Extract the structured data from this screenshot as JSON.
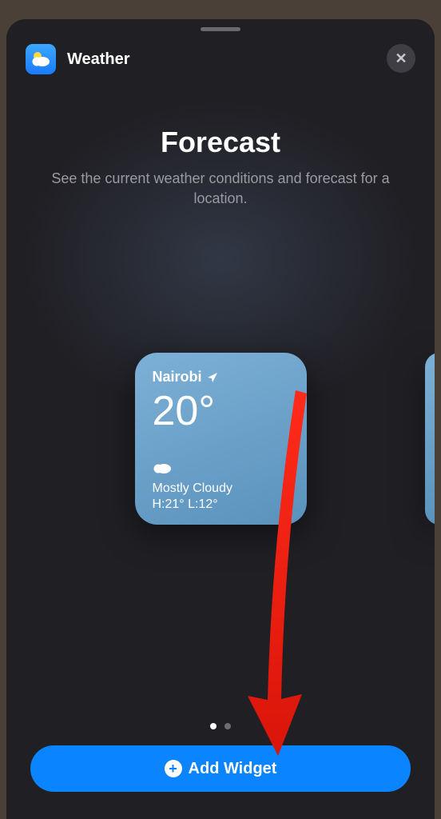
{
  "header": {
    "app_name": "Weather"
  },
  "title_section": {
    "title": "Forecast",
    "subtitle": "See the current weather conditions and forecast for a location."
  },
  "widget": {
    "location": "Nairobi",
    "temperature": "20°",
    "condition": "Mostly Cloudy",
    "high_low": "H:21° L:12°"
  },
  "pagination": {
    "current": 0,
    "total": 2
  },
  "add_button": {
    "label": "Add Widget"
  }
}
